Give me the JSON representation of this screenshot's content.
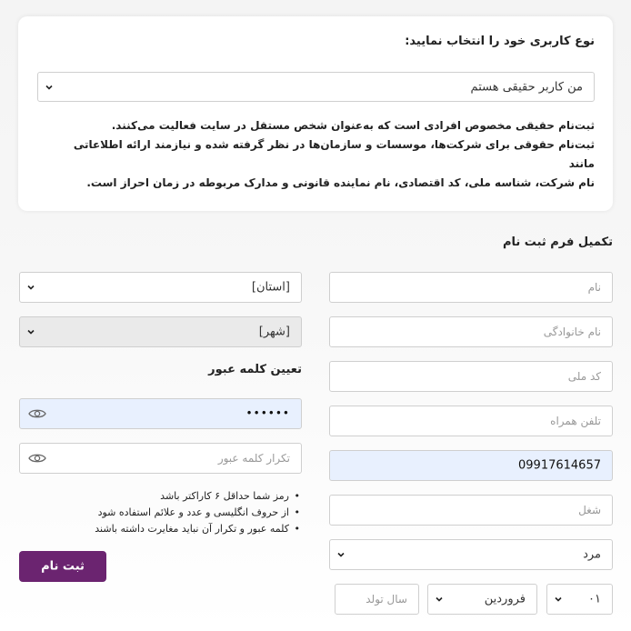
{
  "user_type": {
    "title": "نوع کاربری خود را انتخاب نمایید:",
    "selected": "من کاربر حقیقی هستم",
    "description": [
      "ثبت‌نام حقیقی مخصوص افرادی است که به‌عنوان شخص مستقل در سایت فعالیت می‌کنند.",
      "ثبت‌نام حقوقی برای شرکت‌ها، موسسات و سازمان‌ها در نظر گرفته شده و نیازمند ارائه اطلاعاتی مانند",
      "نام شرکت، شناسه ملی، کد اقتصادی، نام نماینده قانونی و مدارک مربوطه در زمان احراز است."
    ]
  },
  "form": {
    "title": "تکمیل فرم ثبت نام",
    "first_name_placeholder": "نام",
    "last_name_placeholder": "نام خانوادگی",
    "national_code_placeholder": "کد ملی",
    "mobile_placeholder": "تلفن همراه",
    "phone_value": "09917614657",
    "job_placeholder": "شغل",
    "gender": "مرد",
    "birth_day": "۰۱",
    "birth_month": "فروردین",
    "birth_year_placeholder": "سال تولد",
    "province": "[استان]",
    "city": "[شهر]"
  },
  "password": {
    "title": "تعیین کلمه عبور",
    "value_masked": "••••••",
    "repeat_placeholder": "تکرار کلمه عبور",
    "rules": [
      "رمز شما حداقل ۶ کاراکتر باشد",
      "از حروف انگلیسی و عدد و علائم استفاده شود",
      "کلمه عبور و تکرار آن نباید مغایرت داشته باشند"
    ]
  },
  "submit_label": "ثبت نام",
  "colors": {
    "accent": "#6b2470",
    "autofill": "#e8f0fe",
    "border": "#cfcfcf"
  }
}
